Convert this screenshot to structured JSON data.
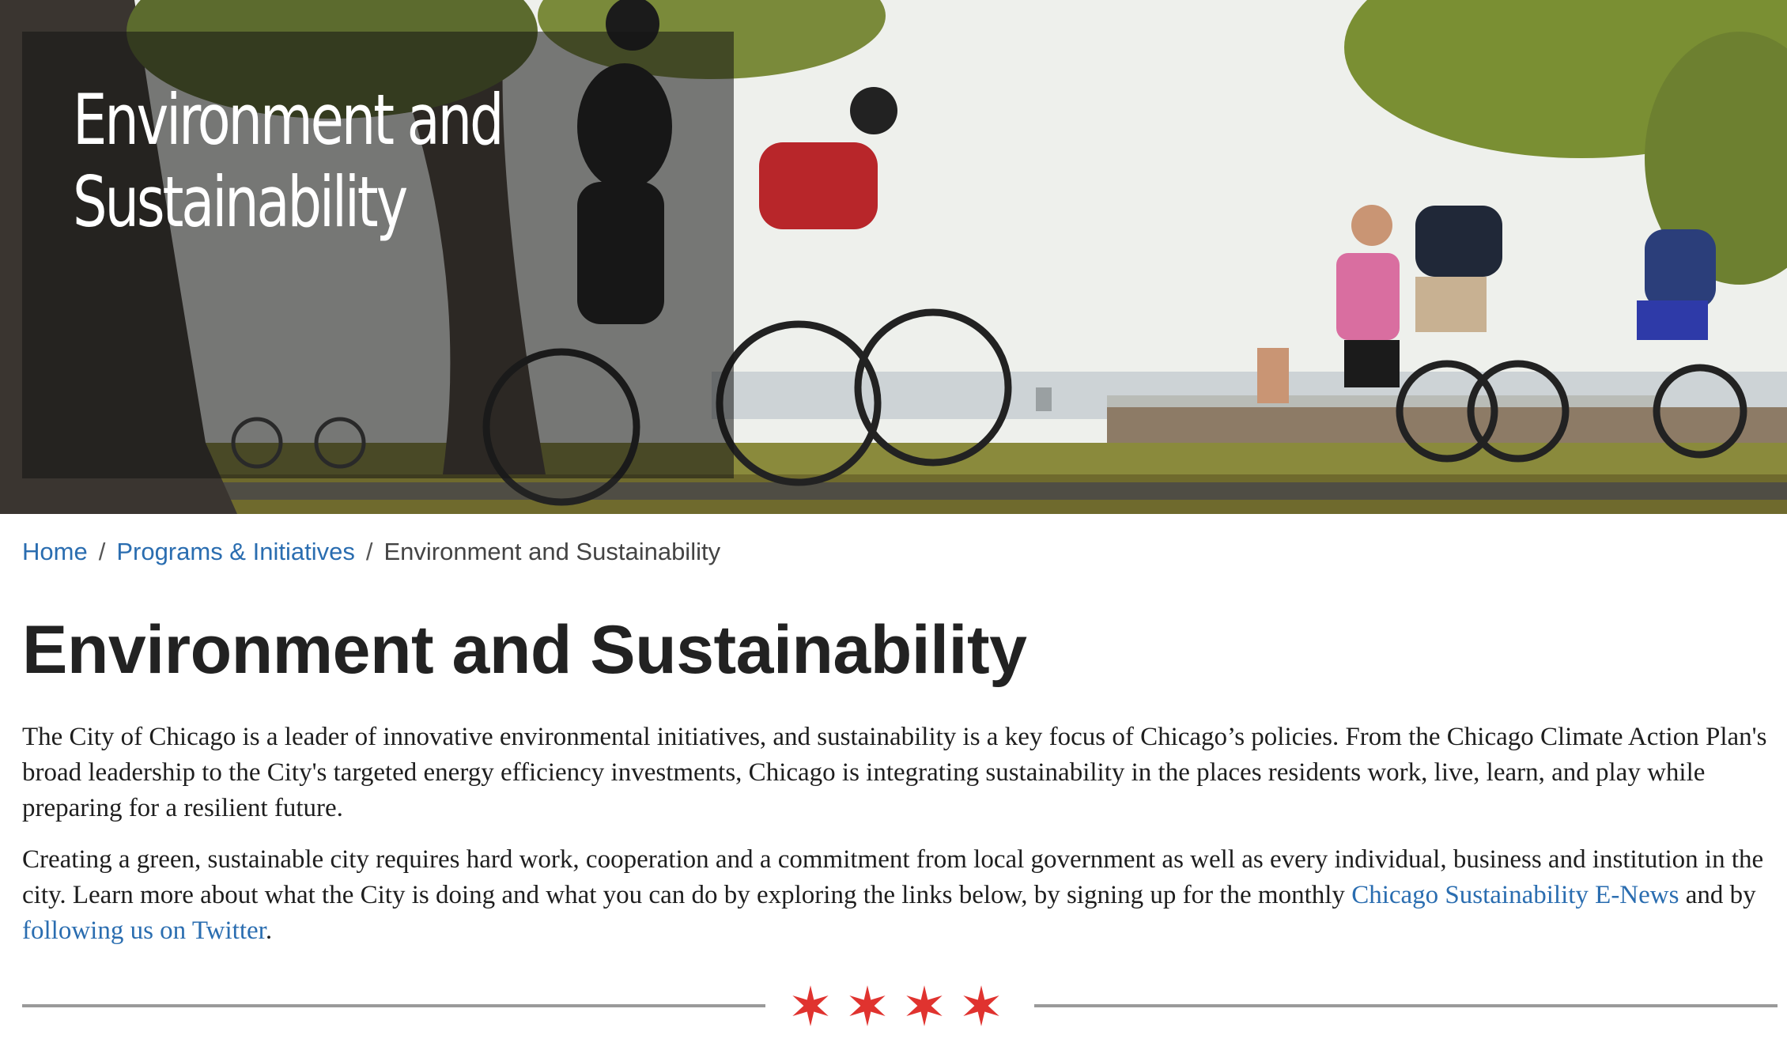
{
  "hero": {
    "title_line1": "Environment and",
    "title_line2": "Sustainability",
    "image_description_icon": "cyclists-photo-icon"
  },
  "breadcrumb": {
    "items": [
      {
        "label": "Home",
        "link": true
      },
      {
        "label": "Programs & Initiatives",
        "link": true
      },
      {
        "label": "Environment and Sustainability",
        "link": false
      }
    ],
    "separator": "/"
  },
  "page": {
    "title": "Environment and Sustainability",
    "p1": "The City of Chicago is a leader of innovative environmental initiatives, and sustainability is a key focus of Chicago’s policies.  From the Chicago Climate Action Plan's broad leadership to the City's targeted energy efficiency investments, Chicago is integrating sustainability in the places residents work, live, learn, and play while preparing for a resilient future.",
    "p2_before": "Creating a green, sustainable city requires hard work, cooperation and a commitment from local government as well as every individual, business and institution in the city. Learn more about what the City is doing and what you can do by exploring the links below, by signing up for the monthly ",
    "p2_link1": "Chicago Sustainability E-News",
    "p2_middle": " and by ",
    "p2_link2": "following us on Twitter",
    "p2_after": "."
  },
  "divider": {
    "star_count": 4,
    "star_color": "#e0332f",
    "line_color": "#9a9a9a"
  },
  "colors": {
    "link": "#2a6db0",
    "text": "#1e1e1e",
    "heading": "#222222"
  }
}
